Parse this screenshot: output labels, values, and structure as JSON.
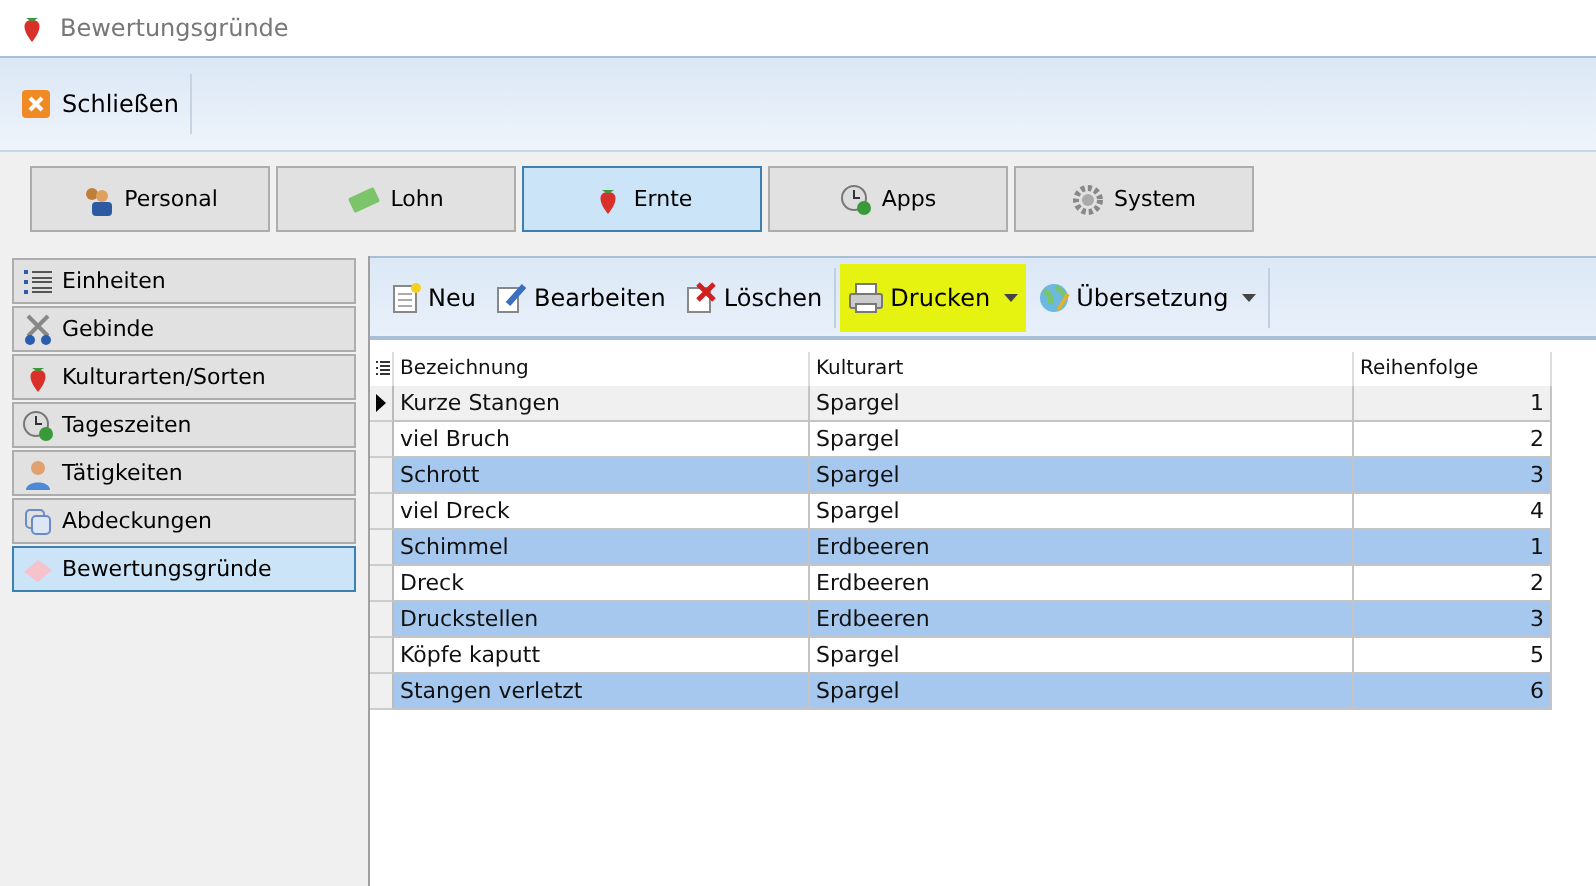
{
  "window": {
    "title": "Bewertungsgründe"
  },
  "ribbon": {
    "buttons": [
      {
        "label": "Schließen"
      }
    ]
  },
  "modules": [
    {
      "label": "Personal",
      "selected": false
    },
    {
      "label": "Lohn",
      "selected": false
    },
    {
      "label": "Ernte",
      "selected": true
    },
    {
      "label": "Apps",
      "selected": false
    },
    {
      "label": "System",
      "selected": false
    }
  ],
  "sidebar": {
    "items": [
      {
        "label": "Einheiten",
        "selected": false
      },
      {
        "label": "Gebinde",
        "selected": false
      },
      {
        "label": "Kulturarten/Sorten",
        "selected": false
      },
      {
        "label": "Tageszeiten",
        "selected": false
      },
      {
        "label": "Tätigkeiten",
        "selected": false
      },
      {
        "label": "Abdeckungen",
        "selected": false
      },
      {
        "label": "Bewertungsgründe",
        "selected": true
      }
    ]
  },
  "toolbar": [
    {
      "label": "Neu",
      "dropdown": false,
      "highlighted": false
    },
    {
      "label": "Bearbeiten",
      "dropdown": false,
      "highlighted": false
    },
    {
      "label": "Löschen",
      "dropdown": false,
      "highlighted": false
    },
    {
      "label": "Drucken",
      "dropdown": true,
      "highlighted": true
    },
    {
      "label": "Übersetzung",
      "dropdown": true,
      "highlighted": false
    }
  ],
  "table": {
    "columns": [
      "Bezeichnung",
      "Kulturart",
      "Reihenfolge"
    ],
    "rows": [
      {
        "cells": [
          "Kurze Stangen",
          "Spargel",
          "1"
        ],
        "current": true,
        "selected": false
      },
      {
        "cells": [
          "viel Bruch",
          "Spargel",
          "2"
        ],
        "current": false,
        "selected": false
      },
      {
        "cells": [
          "Schrott",
          "Spargel",
          "3"
        ],
        "current": false,
        "selected": true
      },
      {
        "cells": [
          "viel Dreck",
          "Spargel",
          "4"
        ],
        "current": false,
        "selected": false
      },
      {
        "cells": [
          "Schimmel",
          "Erdbeeren",
          "1"
        ],
        "current": false,
        "selected": true
      },
      {
        "cells": [
          "Dreck",
          "Erdbeeren",
          "2"
        ],
        "current": false,
        "selected": false
      },
      {
        "cells": [
          "Druckstellen",
          "Erdbeeren",
          "3"
        ],
        "current": false,
        "selected": true
      },
      {
        "cells": [
          "Köpfe kaputt",
          "Spargel",
          "5"
        ],
        "current": false,
        "selected": false
      },
      {
        "cells": [
          "Stangen verletzt",
          "Spargel",
          "6"
        ],
        "current": false,
        "selected": true
      }
    ]
  }
}
